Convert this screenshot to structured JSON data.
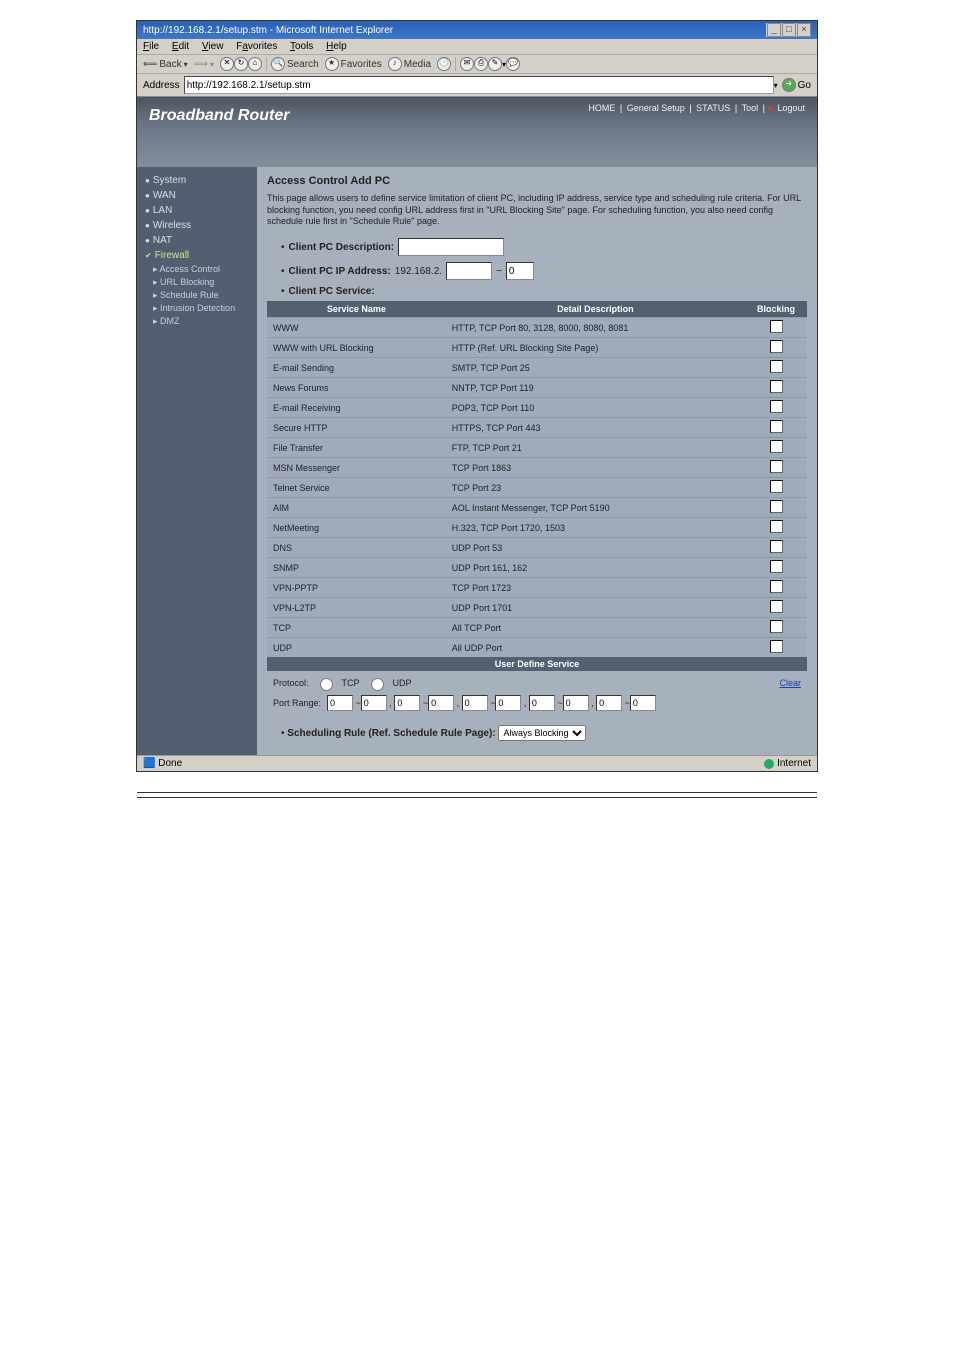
{
  "window": {
    "title": "http://192.168.2.1/setup.stm - Microsoft Internet Explorer",
    "menus": [
      "File",
      "Edit",
      "View",
      "Favorites",
      "Tools",
      "Help"
    ],
    "toolbar": {
      "back": "Back",
      "search": "Search",
      "favorites": "Favorites",
      "media": "Media"
    },
    "address_label": "Address",
    "address_value": "http://192.168.2.1/setup.stm",
    "go": "Go",
    "status_done": "Done",
    "status_zone": "Internet"
  },
  "header": {
    "brand": "Broadband Router",
    "links": [
      "HOME",
      "General Setup",
      "STATUS",
      "Tool"
    ],
    "logout": "Logout"
  },
  "sidebar": {
    "items": [
      {
        "label": "System"
      },
      {
        "label": "WAN"
      },
      {
        "label": "LAN"
      },
      {
        "label": "Wireless"
      },
      {
        "label": "NAT"
      },
      {
        "label": "Firewall"
      }
    ],
    "subitems": [
      {
        "label": "Access Control"
      },
      {
        "label": "URL Blocking"
      },
      {
        "label": "Schedule Rule"
      },
      {
        "label": "Intrusion Detection"
      },
      {
        "label": "DMZ"
      }
    ]
  },
  "page": {
    "title": "Access Control Add PC",
    "intro": "This page allows users to define service limitation of client PC, including IP address, service type and scheduling rule criteria. For URL blocking function, you need config URL address first in \"URL Blocking Site\" page. For scheduling function, you also need config schedule rule first in \"Schedule Rule\" page.",
    "desc_label": "Client PC Description:",
    "desc_value": "",
    "ip_label": "Client PC IP Address:",
    "ip_prefix": "192.168.2.",
    "ip_from": "",
    "ip_to": "0",
    "svc_label": "Client PC Service:",
    "cols": {
      "name": "Service Name",
      "detail": "Detail Description",
      "block": "Blocking"
    },
    "services": [
      {
        "name": "WWW",
        "detail": "HTTP, TCP Port 80, 3128, 8000, 8080, 8081"
      },
      {
        "name": "WWW with URL Blocking",
        "detail": "HTTP (Ref. URL Blocking Site Page)"
      },
      {
        "name": "E-mail Sending",
        "detail": "SMTP, TCP Port 25"
      },
      {
        "name": "News Forums",
        "detail": "NNTP, TCP Port 119"
      },
      {
        "name": "E-mail Receiving",
        "detail": "POP3, TCP Port 110"
      },
      {
        "name": "Secure HTTP",
        "detail": "HTTPS, TCP Port 443"
      },
      {
        "name": "File Transfer",
        "detail": "FTP, TCP Port 21"
      },
      {
        "name": "MSN Messenger",
        "detail": "TCP Port 1863"
      },
      {
        "name": "Telnet Service",
        "detail": "TCP Port 23"
      },
      {
        "name": "AIM",
        "detail": "AOL Instant Messenger, TCP Port 5190"
      },
      {
        "name": "NetMeeting",
        "detail": "H.323, TCP Port 1720, 1503"
      },
      {
        "name": "DNS",
        "detail": "UDP Port 53"
      },
      {
        "name": "SNMP",
        "detail": "UDP Port 161, 162"
      },
      {
        "name": "VPN-PPTP",
        "detail": "TCP Port 1723"
      },
      {
        "name": "VPN-L2TP",
        "detail": "UDP Port 1701"
      },
      {
        "name": "TCP",
        "detail": "All TCP Port"
      },
      {
        "name": "UDP",
        "detail": "All UDP Port"
      }
    ],
    "uds_title": "User Define Service",
    "proto_label": "Protocol:",
    "proto_tcp": "TCP",
    "proto_udp": "UDP",
    "port_label": "Port Range:",
    "port_default": "0",
    "clear": "Clear",
    "sched_label": "Scheduling Rule (Ref. Schedule Rule Page):",
    "sched_value": "Always Blocking"
  }
}
